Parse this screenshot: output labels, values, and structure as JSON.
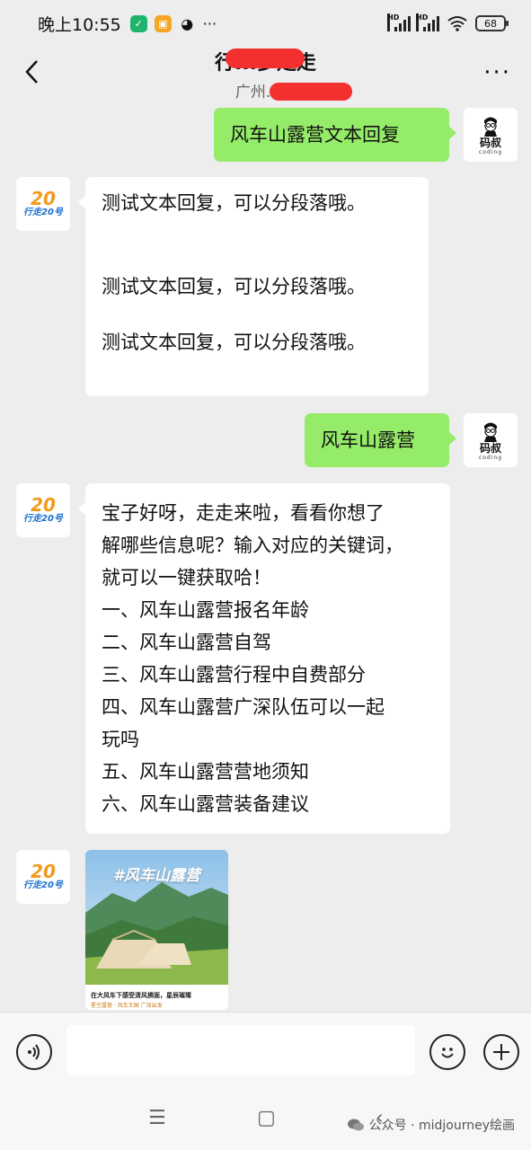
{
  "status_bar": {
    "time": "晚上10:55",
    "network_label": "HD",
    "battery": "68",
    "more_icon": "···"
  },
  "header": {
    "title": "行...多走走",
    "subtitle": "广州...号",
    "back_icon": "‹",
    "more_icon": "···"
  },
  "messages": [
    {
      "side": "mine",
      "lines": [
        "风车山露营文本回复"
      ]
    },
    {
      "side": "theirs",
      "lines": [
        "测试文本回复，可以分段落哦。",
        "",
        "",
        "测试文本回复，可以分段落哦。",
        "",
        "测试文本回复，可以分段落哦。"
      ]
    },
    {
      "side": "mine",
      "lines": [
        "风车山露营"
      ]
    },
    {
      "side": "theirs",
      "lines": [
        "宝子好呀，走走来啦，看看你想了",
        "解哪些信息呢？输入对应的关键词，",
        "就可以一键获取哈！",
        "一、风车山露营报名年龄",
        "二、风车山露营自驾",
        "三、风车山露营行程中自费部分",
        "四、风车山露营广深队伍可以一起",
        "玩吗",
        "五、风车山露营营地须知",
        "六、风车山露营装备建议"
      ]
    }
  ],
  "avatars": {
    "mine_text": "码叔",
    "mine_sub": "coding",
    "theirs_num": "20",
    "theirs_text": "行走20号"
  },
  "image_card": {
    "title": "#风车山露营",
    "caption": "在大风车下感受清风拂面，星辰璀璨",
    "tag": "星空露营 · 风车王国  广深出发"
  },
  "input_bar": {
    "voice_icon": "voice-icon",
    "emoji_icon": "☺",
    "plus_icon": "+"
  },
  "nav_bar": {
    "menu_icon": "☰",
    "home_icon": "▢",
    "back_icon": "‹",
    "watermark": "公众号 · midjourney绘画"
  },
  "colors": {
    "background": "#ededed",
    "bubble_mine": "#95ec69",
    "bubble_theirs": "#ffffff"
  }
}
